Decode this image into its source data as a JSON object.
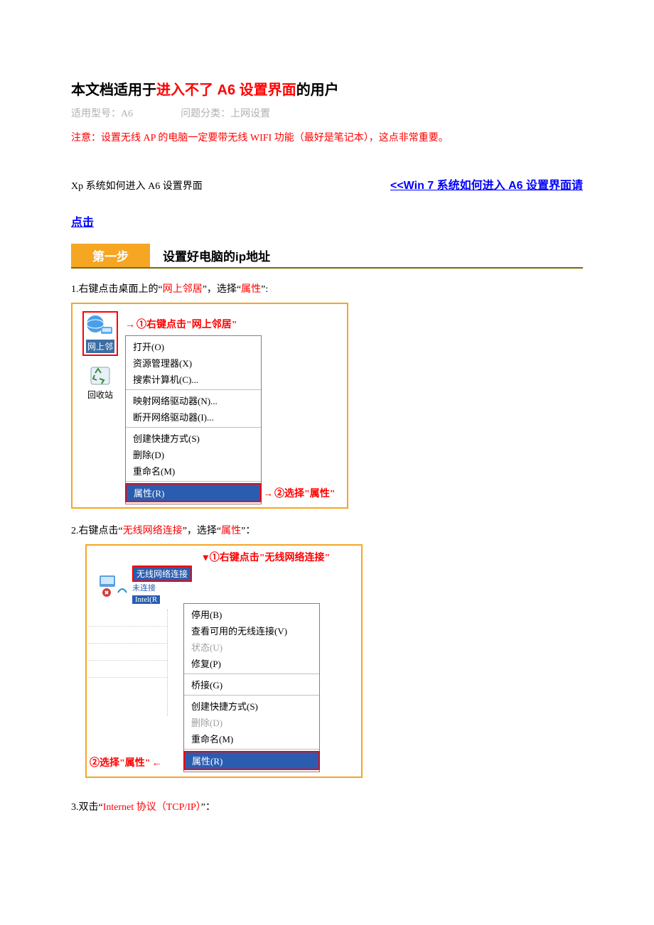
{
  "title_pre": "本文档适用于",
  "title_red": "进入不了 A6 设置界面",
  "title_post": "的用户",
  "meta_model_label": "适用型号：",
  "meta_model_value": "A6",
  "meta_cat_label": "问题分类：",
  "meta_cat_value": "上网设置",
  "warning_text": "注意：设置无线 AP 的电脑一定要带无线 WIFI 功能（最好是笔记本），这点非常重要。",
  "xp_heading": "Xp 系统如何进入 A6 设置界面",
  "win7_link": "<<Win 7 系统如何进入 A6 设置界面请",
  "click_text": "点击",
  "step_tag": "第一步",
  "step_title": "设置好电脑的ip地址",
  "line1_a": "1.右键点击桌面上的“",
  "line1_b": "网上邻居",
  "line1_c": "”，选择“",
  "line1_d": "属性",
  "line1_e": "”:",
  "shot1": {
    "anno1": "①右键点击\"网上邻居\"",
    "icon_label": "网上邻",
    "recycle_label": "回收站",
    "menu": {
      "g1": [
        "打开(O)",
        "资源管理器(X)",
        "搜索计算机(C)..."
      ],
      "g2": [
        "映射网络驱动器(N)...",
        "断开网络驱动器(I)..."
      ],
      "g3": [
        "创建快捷方式(S)",
        "删除(D)",
        "重命名(M)"
      ],
      "g4_hl": "属性(R)"
    },
    "anno2": "②选择\"属性\""
  },
  "line2_a": "2.右键点击“",
  "line2_b": "无线网络连接",
  "line2_c": "”，选择“",
  "line2_d": "属性",
  "line2_e": "”：",
  "shot2": {
    "anno1": "①右键点击\"无线网络连接\"",
    "wlabel": "无线网络连接",
    "wsub1": "未连接",
    "wsub2": "Intel(R",
    "menu": {
      "g1": [
        "停用(B)",
        "查看可用的无线连接(V)"
      ],
      "g1d": "状态(U)",
      "g1b": "修复(P)",
      "g2": [
        "桥接(G)"
      ],
      "g3_a": "创建快捷方式(S)",
      "g3_d": "删除(D)",
      "g3_b": "重命名(M)",
      "g4_hl": "属性(R)"
    },
    "anno2": "②选择\"属性\""
  },
  "line3_a": "3.双击“",
  "line3_b": "Internet 协议（TCP/IP）",
  "line3_c": "”："
}
